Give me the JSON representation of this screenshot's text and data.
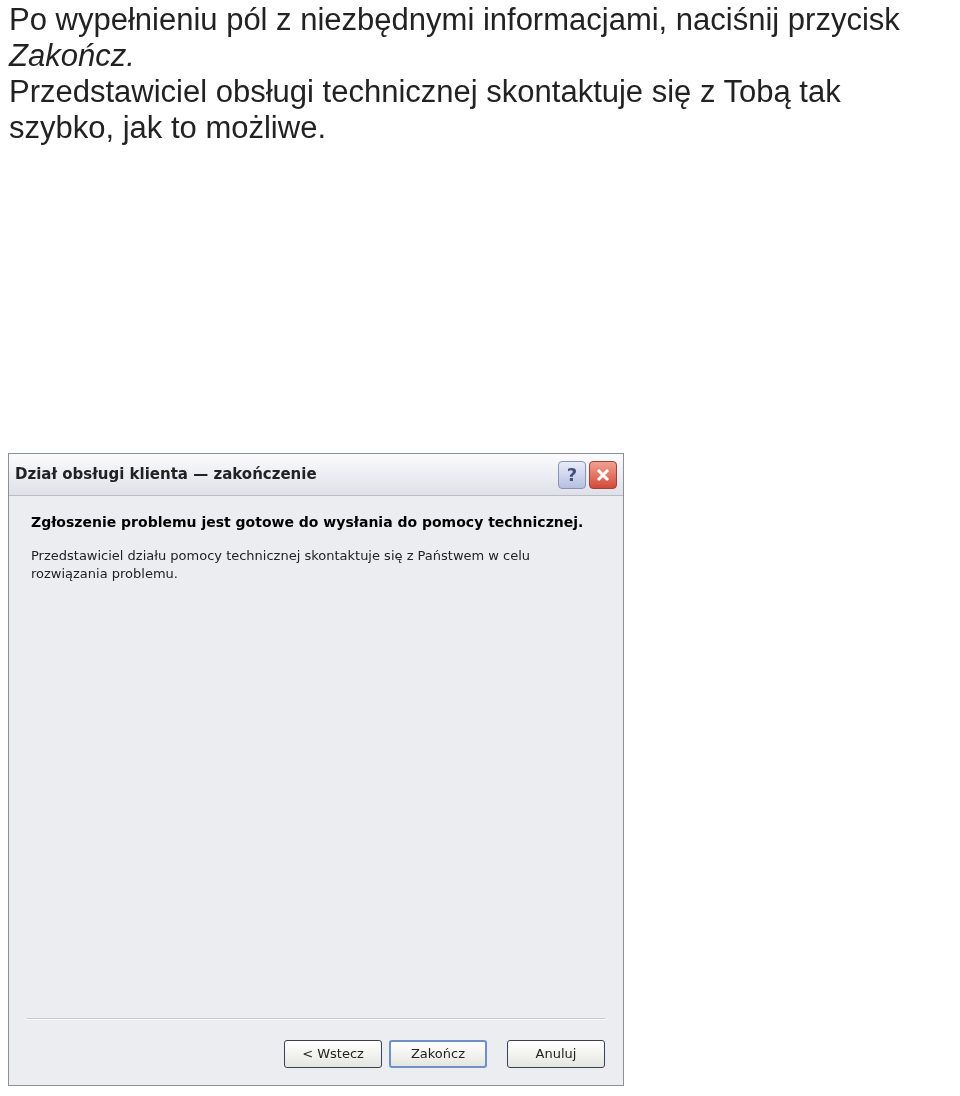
{
  "instructions": [
    "Po wypełnieniu pól z niezbędnymi informacjami, naciśnij przycisk *Zakończ.*",
    "Przedstawiciel obsługi technicznej skontaktuje się z Tobą tak szybko, jak to możliwe."
  ],
  "dialog": {
    "title": "Dział obsługi klienta — zakończenie",
    "title_buttons": [
      {
        "kind": "help",
        "label": "?"
      },
      {
        "kind": "close"
      }
    ],
    "heading": "Zgłoszenie problemu jest gotowe do wysłania do pomocy technicznej.",
    "message": "Przedstawiciel działu pomocy technicznej skontaktuje się z Państwem w celu rozwiązania problemu.",
    "buttons": [
      {
        "label": "< Wstecz",
        "default": false
      },
      {
        "label": "Zakończ",
        "default": true
      },
      {
        "label": "Anuluj",
        "default": false
      }
    ]
  }
}
